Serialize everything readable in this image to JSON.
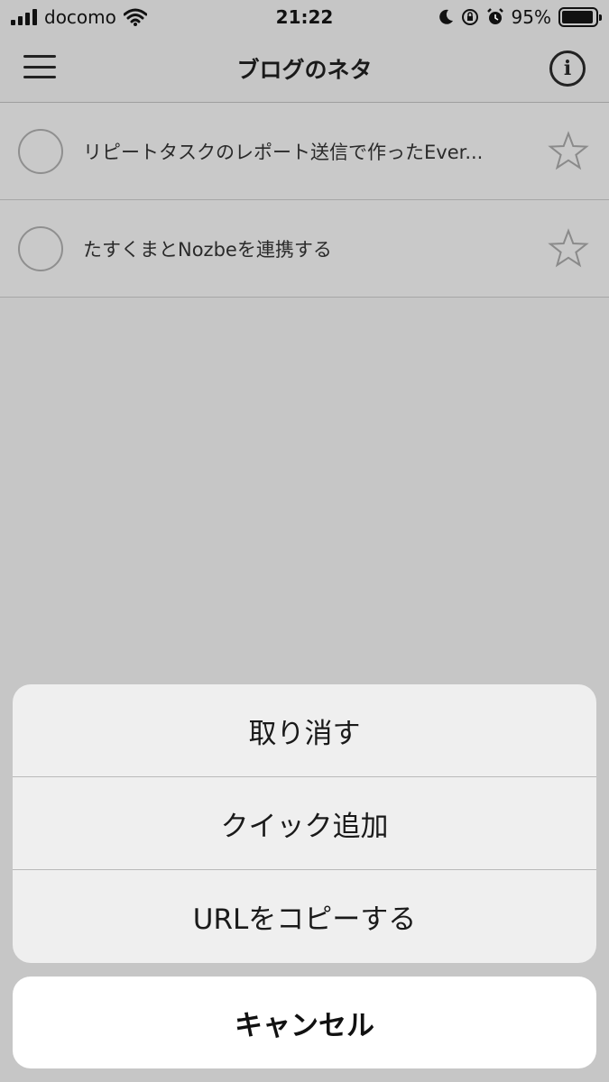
{
  "status_bar": {
    "carrier": "docomo",
    "time": "21:22",
    "battery_percent": "95%",
    "battery_level": 0.95,
    "icons": [
      "signal-icon",
      "wifi-icon",
      "moon-icon",
      "rotation-lock-icon",
      "alarm-icon",
      "battery-icon"
    ]
  },
  "nav": {
    "title": "ブログのネタ",
    "left_icon": "hamburger-menu-icon",
    "right_icon": "info-icon"
  },
  "tasks": [
    {
      "title": "リピートタスクのレポート送信で作ったEver...",
      "completed": false,
      "starred": false
    },
    {
      "title": "たすくまとNozbeを連携する",
      "completed": false,
      "starred": false
    }
  ],
  "action_sheet": {
    "items": [
      {
        "label": "取り消す"
      },
      {
        "label": "クイック追加"
      },
      {
        "label": "URLをコピーする"
      }
    ],
    "cancel_label": "キャンセル"
  },
  "colors": {
    "dimmed_background": "#c6c6c6",
    "sheet_background": "#efefef",
    "cancel_background": "#ffffff",
    "text": "#111111"
  }
}
